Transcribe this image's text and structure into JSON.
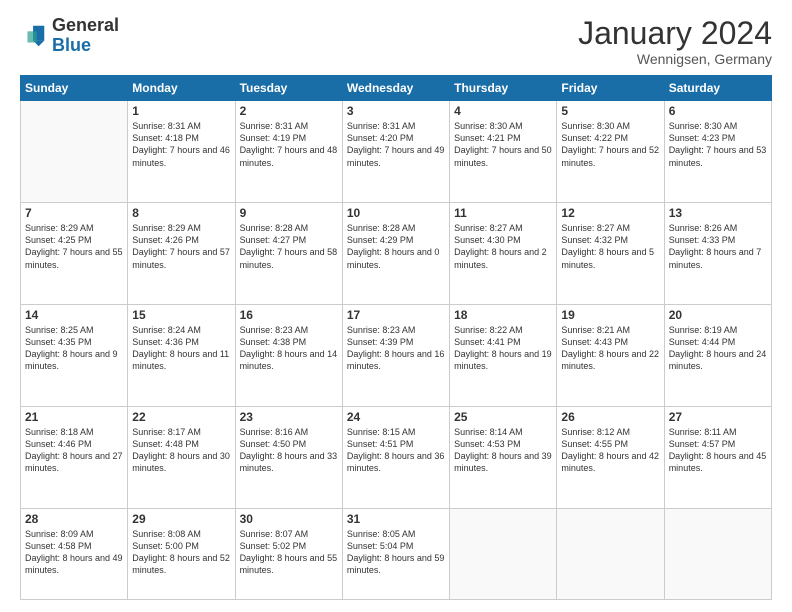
{
  "logo": {
    "general": "General",
    "blue": "Blue"
  },
  "header": {
    "month": "January 2024",
    "location": "Wennigsen, Germany"
  },
  "weekdays": [
    "Sunday",
    "Monday",
    "Tuesday",
    "Wednesday",
    "Thursday",
    "Friday",
    "Saturday"
  ],
  "weeks": [
    [
      {
        "day": "",
        "sunrise": "",
        "sunset": "",
        "daylight": ""
      },
      {
        "day": "1",
        "sunrise": "Sunrise: 8:31 AM",
        "sunset": "Sunset: 4:18 PM",
        "daylight": "Daylight: 7 hours and 46 minutes."
      },
      {
        "day": "2",
        "sunrise": "Sunrise: 8:31 AM",
        "sunset": "Sunset: 4:19 PM",
        "daylight": "Daylight: 7 hours and 48 minutes."
      },
      {
        "day": "3",
        "sunrise": "Sunrise: 8:31 AM",
        "sunset": "Sunset: 4:20 PM",
        "daylight": "Daylight: 7 hours and 49 minutes."
      },
      {
        "day": "4",
        "sunrise": "Sunrise: 8:30 AM",
        "sunset": "Sunset: 4:21 PM",
        "daylight": "Daylight: 7 hours and 50 minutes."
      },
      {
        "day": "5",
        "sunrise": "Sunrise: 8:30 AM",
        "sunset": "Sunset: 4:22 PM",
        "daylight": "Daylight: 7 hours and 52 minutes."
      },
      {
        "day": "6",
        "sunrise": "Sunrise: 8:30 AM",
        "sunset": "Sunset: 4:23 PM",
        "daylight": "Daylight: 7 hours and 53 minutes."
      }
    ],
    [
      {
        "day": "7",
        "sunrise": "Sunrise: 8:29 AM",
        "sunset": "Sunset: 4:25 PM",
        "daylight": "Daylight: 7 hours and 55 minutes."
      },
      {
        "day": "8",
        "sunrise": "Sunrise: 8:29 AM",
        "sunset": "Sunset: 4:26 PM",
        "daylight": "Daylight: 7 hours and 57 minutes."
      },
      {
        "day": "9",
        "sunrise": "Sunrise: 8:28 AM",
        "sunset": "Sunset: 4:27 PM",
        "daylight": "Daylight: 7 hours and 58 minutes."
      },
      {
        "day": "10",
        "sunrise": "Sunrise: 8:28 AM",
        "sunset": "Sunset: 4:29 PM",
        "daylight": "Daylight: 8 hours and 0 minutes."
      },
      {
        "day": "11",
        "sunrise": "Sunrise: 8:27 AM",
        "sunset": "Sunset: 4:30 PM",
        "daylight": "Daylight: 8 hours and 2 minutes."
      },
      {
        "day": "12",
        "sunrise": "Sunrise: 8:27 AM",
        "sunset": "Sunset: 4:32 PM",
        "daylight": "Daylight: 8 hours and 5 minutes."
      },
      {
        "day": "13",
        "sunrise": "Sunrise: 8:26 AM",
        "sunset": "Sunset: 4:33 PM",
        "daylight": "Daylight: 8 hours and 7 minutes."
      }
    ],
    [
      {
        "day": "14",
        "sunrise": "Sunrise: 8:25 AM",
        "sunset": "Sunset: 4:35 PM",
        "daylight": "Daylight: 8 hours and 9 minutes."
      },
      {
        "day": "15",
        "sunrise": "Sunrise: 8:24 AM",
        "sunset": "Sunset: 4:36 PM",
        "daylight": "Daylight: 8 hours and 11 minutes."
      },
      {
        "day": "16",
        "sunrise": "Sunrise: 8:23 AM",
        "sunset": "Sunset: 4:38 PM",
        "daylight": "Daylight: 8 hours and 14 minutes."
      },
      {
        "day": "17",
        "sunrise": "Sunrise: 8:23 AM",
        "sunset": "Sunset: 4:39 PM",
        "daylight": "Daylight: 8 hours and 16 minutes."
      },
      {
        "day": "18",
        "sunrise": "Sunrise: 8:22 AM",
        "sunset": "Sunset: 4:41 PM",
        "daylight": "Daylight: 8 hours and 19 minutes."
      },
      {
        "day": "19",
        "sunrise": "Sunrise: 8:21 AM",
        "sunset": "Sunset: 4:43 PM",
        "daylight": "Daylight: 8 hours and 22 minutes."
      },
      {
        "day": "20",
        "sunrise": "Sunrise: 8:19 AM",
        "sunset": "Sunset: 4:44 PM",
        "daylight": "Daylight: 8 hours and 24 minutes."
      }
    ],
    [
      {
        "day": "21",
        "sunrise": "Sunrise: 8:18 AM",
        "sunset": "Sunset: 4:46 PM",
        "daylight": "Daylight: 8 hours and 27 minutes."
      },
      {
        "day": "22",
        "sunrise": "Sunrise: 8:17 AM",
        "sunset": "Sunset: 4:48 PM",
        "daylight": "Daylight: 8 hours and 30 minutes."
      },
      {
        "day": "23",
        "sunrise": "Sunrise: 8:16 AM",
        "sunset": "Sunset: 4:50 PM",
        "daylight": "Daylight: 8 hours and 33 minutes."
      },
      {
        "day": "24",
        "sunrise": "Sunrise: 8:15 AM",
        "sunset": "Sunset: 4:51 PM",
        "daylight": "Daylight: 8 hours and 36 minutes."
      },
      {
        "day": "25",
        "sunrise": "Sunrise: 8:14 AM",
        "sunset": "Sunset: 4:53 PM",
        "daylight": "Daylight: 8 hours and 39 minutes."
      },
      {
        "day": "26",
        "sunrise": "Sunrise: 8:12 AM",
        "sunset": "Sunset: 4:55 PM",
        "daylight": "Daylight: 8 hours and 42 minutes."
      },
      {
        "day": "27",
        "sunrise": "Sunrise: 8:11 AM",
        "sunset": "Sunset: 4:57 PM",
        "daylight": "Daylight: 8 hours and 45 minutes."
      }
    ],
    [
      {
        "day": "28",
        "sunrise": "Sunrise: 8:09 AM",
        "sunset": "Sunset: 4:58 PM",
        "daylight": "Daylight: 8 hours and 49 minutes."
      },
      {
        "day": "29",
        "sunrise": "Sunrise: 8:08 AM",
        "sunset": "Sunset: 5:00 PM",
        "daylight": "Daylight: 8 hours and 52 minutes."
      },
      {
        "day": "30",
        "sunrise": "Sunrise: 8:07 AM",
        "sunset": "Sunset: 5:02 PM",
        "daylight": "Daylight: 8 hours and 55 minutes."
      },
      {
        "day": "31",
        "sunrise": "Sunrise: 8:05 AM",
        "sunset": "Sunset: 5:04 PM",
        "daylight": "Daylight: 8 hours and 59 minutes."
      },
      {
        "day": "",
        "sunrise": "",
        "sunset": "",
        "daylight": ""
      },
      {
        "day": "",
        "sunrise": "",
        "sunset": "",
        "daylight": ""
      },
      {
        "day": "",
        "sunrise": "",
        "sunset": "",
        "daylight": ""
      }
    ]
  ]
}
